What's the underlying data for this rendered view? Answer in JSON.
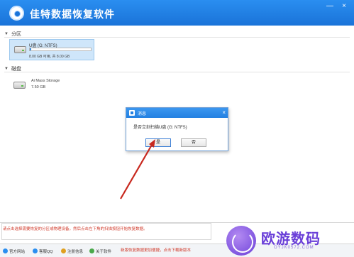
{
  "app": {
    "title": "佳特数据恢复软件",
    "window_controls": [
      "—",
      "×"
    ]
  },
  "partitions": {
    "heading": "分区",
    "items": [
      {
        "name": "U盘 (G: NTFS)",
        "info": "8.00 GB 可用, 共 8.00 GB",
        "used_fraction": 0.02
      }
    ]
  },
  "disks": {
    "heading": "磁盘",
    "items": [
      {
        "name": "Ai Mass Storage",
        "size": "7.50 GB"
      }
    ]
  },
  "dialog": {
    "title": "消息",
    "message": "是否立刻扫描U盘 (G: NTFS)",
    "ok_label": "是",
    "cancel_label": "否",
    "close": "×"
  },
  "notice": {
    "text": "请点击选择需要恢复的分区或物理设备，然后点击左下角的扫描按钮开始恢复数据。"
  },
  "bottombar": {
    "buttons": [
      {
        "label": "官方网站",
        "icon": "home-icon",
        "color": "#2a8ef0"
      },
      {
        "label": "客服QQ",
        "icon": "qq-icon",
        "color": "#2a8ef0"
      },
      {
        "label": "注册信息",
        "icon": "key-icon",
        "color": "#e0a020"
      },
      {
        "label": "关于软件",
        "icon": "info-icon",
        "color": "#4aa84a"
      }
    ],
    "promo": "新版恢复数据更加便捷，点击下载新版本"
  },
  "watermark": {
    "brand": "欧游数码",
    "url": "OYJK0572.COM"
  },
  "colors": {
    "titlebar": "#1a73d8",
    "selection": "#cfe6fa",
    "notice": "#d0392a",
    "arrow": "#c8281e"
  }
}
